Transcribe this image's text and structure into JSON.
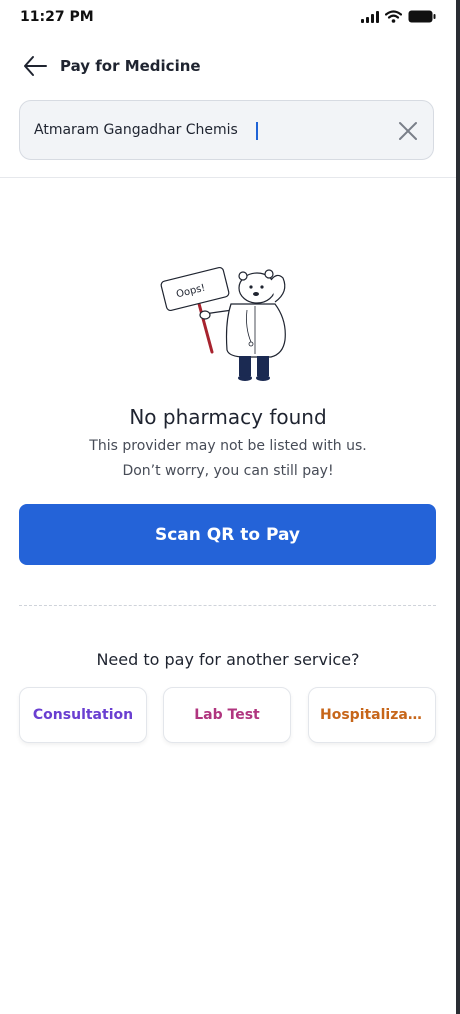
{
  "status": {
    "time": "11:27 PM",
    "icons": [
      "cellular-signal-icon",
      "wifi-icon",
      "battery-icon"
    ]
  },
  "header": {
    "title": "Pay for Medicine",
    "back_icon": "arrow-left-icon"
  },
  "search": {
    "value": "Atmaram Gangadhar Chemis",
    "clear_icon": "close-icon"
  },
  "empty_state": {
    "sign_text": "Oops!",
    "title": "No pharmacy found",
    "line1": "This provider may not be listed with us.",
    "line2": "Don’t worry, you can still pay!"
  },
  "scan_button": {
    "label": "Scan QR to Pay",
    "color": "#2463d8"
  },
  "other_services": {
    "title": "Need to pay for another service?",
    "items": [
      {
        "label": "Consultation",
        "color": "#6a3fd1"
      },
      {
        "label": "Lab Test",
        "color": "#b0357f"
      },
      {
        "label": "Hospitalization",
        "color": "#c7661a"
      }
    ]
  }
}
